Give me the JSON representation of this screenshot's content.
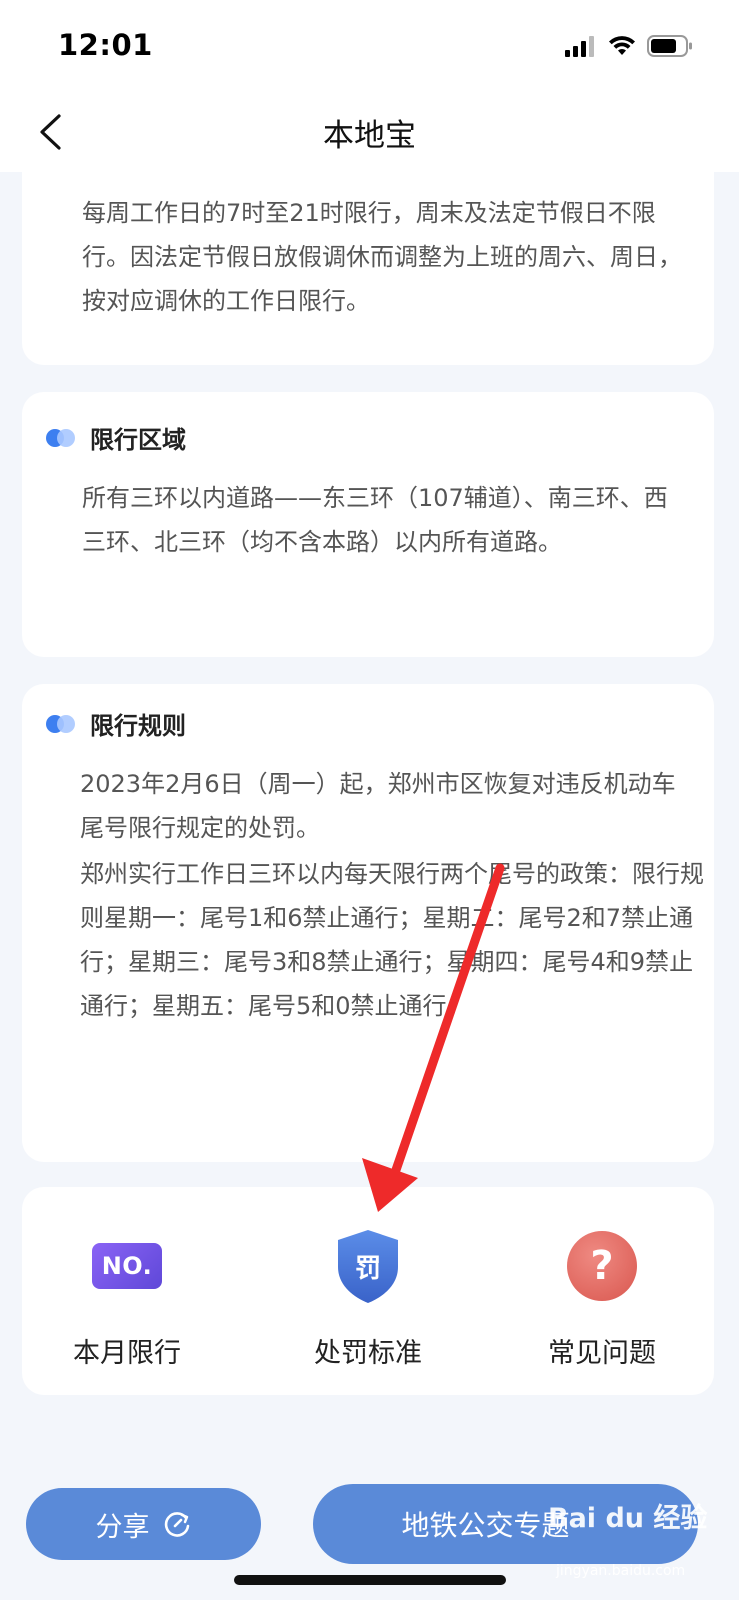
{
  "status_bar": {
    "time": "12:01"
  },
  "nav": {
    "title": "本地宝"
  },
  "time_card": {
    "text": "每周工作日的7时至21时限行，周末及法定节假日不限行。因法定节假日放假调休而调整为上班的周六、周日，按对应调休的工作日限行。"
  },
  "area_card": {
    "title": "限行区域",
    "text": "所有三环以内道路——东三环（107辅道）、南三环、西三环、北三环（均不含本路）以内所有道路。"
  },
  "rule_card": {
    "title": "限行规则",
    "para1": "2023年2月6日（周一）起，郑州市区恢复对违反机动车尾号限行规定的处罚。",
    "para2": "郑州实行工作日三环以内每天限行两个尾号的政策：限行规则星期一：尾号1和6禁止通行；星期二：尾号2和7禁止通行；星期三：尾号3和8禁止通行；星期四：尾号4和9禁止通行；星期五：尾号5和0禁止通行。"
  },
  "actions": [
    {
      "label": "本月限行",
      "icon_text": "NO.",
      "icon": "no-badge-icon"
    },
    {
      "label": "处罚标准",
      "icon_text": "罚",
      "icon": "penalty-shield-icon"
    },
    {
      "label": "常见问题",
      "icon_text": "?",
      "icon": "question-circle-icon"
    }
  ],
  "bottom": {
    "share_label": "分享",
    "metro_label": "地铁公交专题"
  },
  "watermark": {
    "main": "Bai du 经验",
    "sub": "jingyan.baidu.com"
  },
  "colors": {
    "accent_blue": "#5a8ad8",
    "dot_blue": "#3d7ff0",
    "arrow_red": "#ee2a2a",
    "badge_purple": "#6f52e6",
    "question_red": "#d9574f"
  }
}
